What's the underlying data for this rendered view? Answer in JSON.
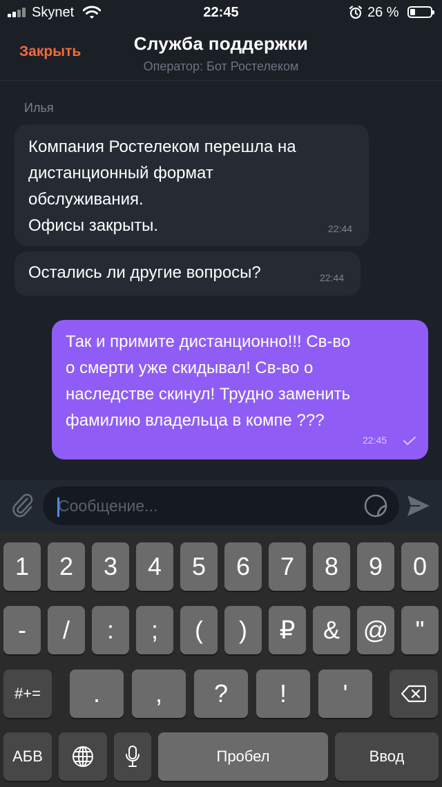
{
  "status_bar": {
    "carrier": "Skynet",
    "time": "22:45",
    "battery_percent": "26 %",
    "battery_level": 0.26,
    "icons": [
      "signal-icon",
      "wifi-icon",
      "alarm-icon",
      "battery-icon"
    ]
  },
  "header": {
    "close_label": "Закрыть",
    "title": "Служба поддержки",
    "subtitle": "Оператор: Бот Ростелеком"
  },
  "colors": {
    "accent": "#f26b3a",
    "outgoing_bubble": "#8f5df5",
    "incoming_bubble": "#262b33",
    "background": "#1c2128"
  },
  "chat": {
    "sender_name": "Илья",
    "messages": [
      {
        "direction": "incoming",
        "text": "Компания Ростелеком перешла на\nдистанционный формат\nобслуживания.\nОфисы закрыты.",
        "time": "22:44"
      },
      {
        "direction": "incoming",
        "text": "Остались ли другие вопросы?",
        "time": "22:44"
      },
      {
        "direction": "outgoing",
        "text": "Так и примите дистанционно!!! Св-во\nо смерти уже скидывал! Св-во о\nнаследстве скинул! Трудно заменить\nфамилию владельца в компе ???",
        "time": "22:45",
        "status_icon": "check-icon"
      }
    ]
  },
  "input": {
    "placeholder": "Сообщение...",
    "icons": [
      "paperclip-icon",
      "sticker-icon",
      "send-icon"
    ]
  },
  "keyboard": {
    "row1": [
      "1",
      "2",
      "3",
      "4",
      "5",
      "6",
      "7",
      "8",
      "9",
      "0"
    ],
    "row2": [
      "-",
      "/",
      ":",
      ";",
      "(",
      ")",
      "₽",
      "&",
      "@",
      "\""
    ],
    "row3": [
      "#+=",
      ".",
      ",",
      "?",
      "!",
      "'"
    ],
    "row3_icon": "backspace-icon",
    "row4": {
      "lang": "АБВ",
      "space": "Пробел",
      "enter": "Ввод",
      "icons": [
        "globe-icon",
        "microphone-icon"
      ]
    }
  }
}
